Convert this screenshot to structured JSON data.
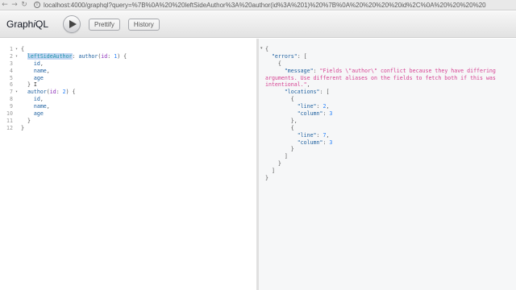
{
  "browser": {
    "url": "localhost:4000/graphql?query=%7B%0A%20%20leftSideAuthor%3A%20author(id%3A%201)%20%7B%0A%20%20%20%20id%2C%0A%20%20%20%20"
  },
  "toolbar": {
    "title_prefix": "Graph",
    "title_italic": "i",
    "title_suffix": "QL",
    "prettify_label": "Prettify",
    "history_label": "History"
  },
  "editor": {
    "line_numbers": [
      "1",
      "2",
      "3",
      "4",
      "5",
      "6",
      "7",
      "8",
      "9",
      "10",
      "11",
      "12"
    ],
    "fold_markers": [
      "▾",
      "▾",
      "",
      "",
      "",
      "",
      "▾",
      "",
      "",
      "",
      "",
      ""
    ],
    "lines": [
      [
        {
          "t": "{",
          "c": "kw-punc"
        }
      ],
      [
        {
          "t": "  ",
          "c": ""
        },
        {
          "t": "leftSideAuthor",
          "c": "alias"
        },
        {
          "t": ": ",
          "c": "kw-punc"
        },
        {
          "t": "author",
          "c": "field"
        },
        {
          "t": "(",
          "c": "kw-punc"
        },
        {
          "t": "id",
          "c": "arg"
        },
        {
          "t": ": ",
          "c": "kw-punc"
        },
        {
          "t": "1",
          "c": "num"
        },
        {
          "t": ") {",
          "c": "kw-punc"
        }
      ],
      [
        {
          "t": "    ",
          "c": ""
        },
        {
          "t": "id",
          "c": "field"
        },
        {
          "t": ",",
          "c": "kw-punc"
        }
      ],
      [
        {
          "t": "    ",
          "c": ""
        },
        {
          "t": "name",
          "c": "field"
        },
        {
          "t": ",",
          "c": "kw-punc"
        }
      ],
      [
        {
          "t": "    ",
          "c": ""
        },
        {
          "t": "age",
          "c": "field"
        }
      ],
      [
        {
          "t": "  }",
          "c": "kw-punc"
        },
        {
          "t": " I",
          "c": "caret"
        }
      ],
      [
        {
          "t": "  ",
          "c": ""
        },
        {
          "t": "author",
          "c": "field"
        },
        {
          "t": "(",
          "c": "kw-punc"
        },
        {
          "t": "id",
          "c": "arg"
        },
        {
          "t": ": ",
          "c": "kw-punc"
        },
        {
          "t": "2",
          "c": "num"
        },
        {
          "t": ") {",
          "c": "kw-punc"
        }
      ],
      [
        {
          "t": "    ",
          "c": ""
        },
        {
          "t": "id",
          "c": "field"
        },
        {
          "t": ",",
          "c": "kw-punc"
        }
      ],
      [
        {
          "t": "    ",
          "c": ""
        },
        {
          "t": "name",
          "c": "field"
        },
        {
          "t": ",",
          "c": "kw-punc"
        }
      ],
      [
        {
          "t": "    ",
          "c": ""
        },
        {
          "t": "age",
          "c": "field"
        }
      ],
      [
        {
          "t": "  }",
          "c": "kw-punc"
        }
      ],
      [
        {
          "t": "}",
          "c": "kw-punc"
        }
      ]
    ]
  },
  "result": {
    "fold_markers": [
      "▾",
      "",
      "",
      "",
      "",
      "",
      "",
      "",
      "",
      "",
      "",
      "",
      "",
      "",
      "",
      "",
      "",
      "",
      ""
    ],
    "lines": [
      [
        {
          "t": "{",
          "c": "kw-punc"
        }
      ],
      [
        {
          "t": "  ",
          "c": ""
        },
        {
          "t": "\"errors\"",
          "c": "prop"
        },
        {
          "t": ": [",
          "c": "kw-punc"
        }
      ],
      [
        {
          "t": "    {",
          "c": "kw-punc"
        }
      ],
      [
        {
          "t": "      ",
          "c": ""
        },
        {
          "t": "\"message\"",
          "c": "prop"
        },
        {
          "t": ": ",
          "c": "kw-punc"
        },
        {
          "t": "\"Fields \\\"author\\\" conflict because they have differing",
          "c": "str"
        }
      ],
      [
        {
          "t": "arguments. Use different aliases on the fields to fetch both if this was",
          "c": "str"
        }
      ],
      [
        {
          "t": "intentional.\"",
          "c": "str"
        },
        {
          "t": ",",
          "c": "kw-punc"
        }
      ],
      [
        {
          "t": "      ",
          "c": ""
        },
        {
          "t": "\"locations\"",
          "c": "prop"
        },
        {
          "t": ": [",
          "c": "kw-punc"
        }
      ],
      [
        {
          "t": "        {",
          "c": "kw-punc"
        }
      ],
      [
        {
          "t": "          ",
          "c": ""
        },
        {
          "t": "\"line\"",
          "c": "prop"
        },
        {
          "t": ": ",
          "c": "kw-punc"
        },
        {
          "t": "2",
          "c": "num"
        },
        {
          "t": ",",
          "c": "kw-punc"
        }
      ],
      [
        {
          "t": "          ",
          "c": ""
        },
        {
          "t": "\"column\"",
          "c": "prop"
        },
        {
          "t": ": ",
          "c": "kw-punc"
        },
        {
          "t": "3",
          "c": "num"
        }
      ],
      [
        {
          "t": "        },",
          "c": "kw-punc"
        }
      ],
      [
        {
          "t": "        {",
          "c": "kw-punc"
        }
      ],
      [
        {
          "t": "          ",
          "c": ""
        },
        {
          "t": "\"line\"",
          "c": "prop"
        },
        {
          "t": ": ",
          "c": "kw-punc"
        },
        {
          "t": "7",
          "c": "num"
        },
        {
          "t": ",",
          "c": "kw-punc"
        }
      ],
      [
        {
          "t": "          ",
          "c": ""
        },
        {
          "t": "\"column\"",
          "c": "prop"
        },
        {
          "t": ": ",
          "c": "kw-punc"
        },
        {
          "t": "3",
          "c": "num"
        }
      ],
      [
        {
          "t": "        }",
          "c": "kw-punc"
        }
      ],
      [
        {
          "t": "      ]",
          "c": "kw-punc"
        }
      ],
      [
        {
          "t": "    }",
          "c": "kw-punc"
        }
      ],
      [
        {
          "t": "  ]",
          "c": "kw-punc"
        }
      ],
      [
        {
          "t": "}",
          "c": "kw-punc"
        }
      ]
    ]
  }
}
